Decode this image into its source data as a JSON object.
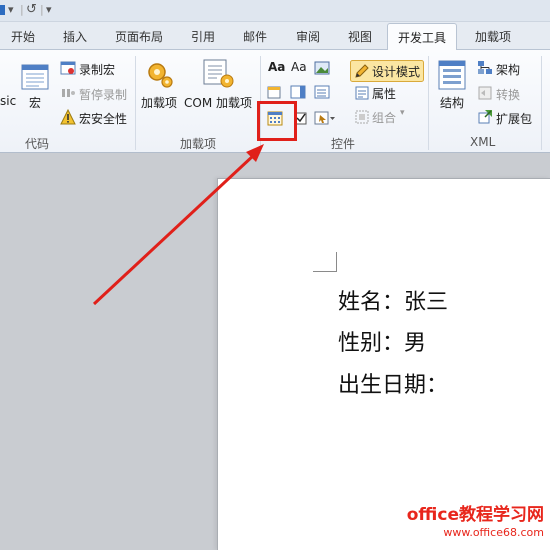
{
  "qat": {
    "redo_glyph": "↺",
    "customize_glyph": "▾"
  },
  "tabs": [
    {
      "label": "开始"
    },
    {
      "label": "插入"
    },
    {
      "label": "页面布局"
    },
    {
      "label": "引用"
    },
    {
      "label": "邮件"
    },
    {
      "label": "审阅"
    },
    {
      "label": "视图"
    },
    {
      "label": "开发工具",
      "active": true
    },
    {
      "label": "加载项"
    }
  ],
  "ribbon": {
    "code": {
      "group_label": "代码",
      "vb_partial": "sic",
      "macros": "宏",
      "record_macro": "录制宏",
      "pause_recording": "暂停录制",
      "macro_security": "宏安全性"
    },
    "addins": {
      "group_label": "加载项",
      "addins": "加载项",
      "com_addins": "COM 加载项"
    },
    "controls": {
      "group_label": "控件",
      "rich_text": "Aa",
      "plain_text": "Aa",
      "design_mode": "设计模式",
      "properties": "属性",
      "group": "组合"
    },
    "xml": {
      "group_label": "XML",
      "structure": "结构",
      "schema": "架构",
      "transform": "转换",
      "expansion_packs": "扩展包"
    }
  },
  "document": {
    "lines": [
      "姓名：张三",
      "性别：男",
      "出生日期："
    ]
  },
  "watermark": {
    "title": "office教程学习网",
    "url": "www.office68.com"
  },
  "colors": {
    "highlight": "#e0201a",
    "accent_tab": "#fbfcfe",
    "design_mode_bg": "#fbe6a2"
  }
}
